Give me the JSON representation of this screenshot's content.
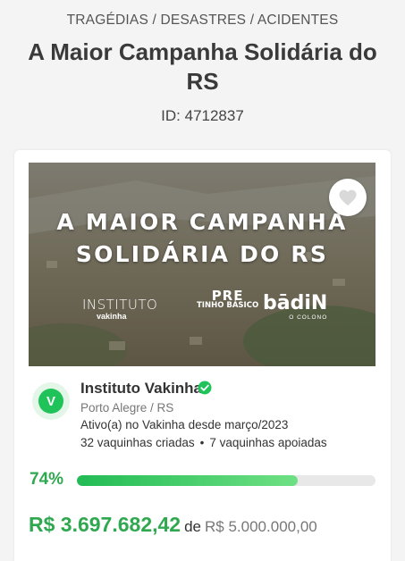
{
  "page": {
    "category": "TRAGÉDIAS / DESASTRES / ACIDENTES",
    "title": "A Maior Campanha Solidária do RS",
    "campaign_id": "ID: 4712837"
  },
  "banner": {
    "headline_line1": "A MAIOR CAMPANHA",
    "headline_line2": "SOLIDÁRIA DO RS",
    "logos": {
      "instituto_big": "INSTITUTO",
      "instituto_small": "vakinha",
      "pre_top": "PRE",
      "pre_bottom": "TINHO BÁSICO",
      "badin_big": "bādiN",
      "badin_small": "O COLONO"
    },
    "favorite_icon": "heart-icon"
  },
  "organizer": {
    "avatar_letter": "V",
    "name": "Instituto Vakinha",
    "location": "Porto Alegre / RS",
    "since": "Ativo(a) no Vakinha desde março/2023",
    "created": "32 vaquinhas criadas",
    "separator": "•",
    "supported": "7 vaquinhas apoiadas",
    "verified_icon": "verified-check-icon"
  },
  "progress": {
    "label": "74%",
    "fraction": 0.74
  },
  "funding": {
    "raised": "R$ 3.697.682,42",
    "of_label": "de",
    "goal": "R$ 5.000.000,00"
  },
  "colors": {
    "accent_green": "#2fa84f",
    "verified_green": "#1fc35a"
  }
}
